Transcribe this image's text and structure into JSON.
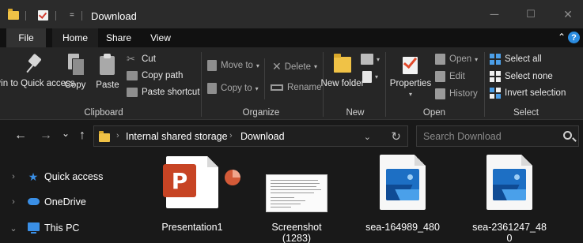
{
  "window": {
    "title": "Download",
    "qa_arrow": "=",
    "minimize": "─",
    "maximize": "☐",
    "close": "✕"
  },
  "tabs": [
    {
      "label": "File"
    },
    {
      "label": "Home"
    },
    {
      "label": "Share"
    },
    {
      "label": "View"
    }
  ],
  "ribbon": {
    "collapse_glyph": "⌃",
    "help_glyph": "?",
    "clipboard": {
      "label": "Clipboard",
      "pin": "Pin to Quick access",
      "copy": "Copy",
      "paste": "Paste",
      "cut": "Cut",
      "copy_path": "Copy path",
      "paste_shortcut": "Paste shortcut"
    },
    "organize": {
      "label": "Organize",
      "move_to": "Move to",
      "copy_to": "Copy to",
      "delete": "Delete",
      "rename": "Rename"
    },
    "new": {
      "label": "New",
      "new_folder": "New folder"
    },
    "open": {
      "label": "Open",
      "properties": "Properties",
      "open": "Open",
      "edit": "Edit",
      "history": "History"
    },
    "select": {
      "label": "Select",
      "select_all": "Select all",
      "select_none": "Select none",
      "invert": "Invert selection"
    }
  },
  "nav": {
    "back": "←",
    "forward": "→",
    "recent": "⌄",
    "up": "↑",
    "breadcrumb": [
      "Internal shared storage",
      "Download"
    ],
    "crumb_sep": "›",
    "search_placeholder": "Search Download",
    "dropdown": "⌄",
    "refresh": "↻"
  },
  "sidebar": {
    "items": [
      {
        "label": "Quick access",
        "chev": "›"
      },
      {
        "label": "OneDrive",
        "chev": "›"
      },
      {
        "label": "This PC",
        "chev": "⌄"
      }
    ]
  },
  "files": [
    {
      "line1": "Presentation1",
      "line2": "",
      "type": "pptx"
    },
    {
      "line1": "Screenshot",
      "line2": "(1283)",
      "type": "screenshot"
    },
    {
      "line1": "sea-164989_480",
      "line2": "",
      "type": "image"
    },
    {
      "line1": "sea-2361247_48",
      "line2": "0",
      "type": "image"
    }
  ],
  "colors": {
    "accent": "#3a8fe6",
    "folder": "#f0c246",
    "powerpoint": "#c74424"
  }
}
